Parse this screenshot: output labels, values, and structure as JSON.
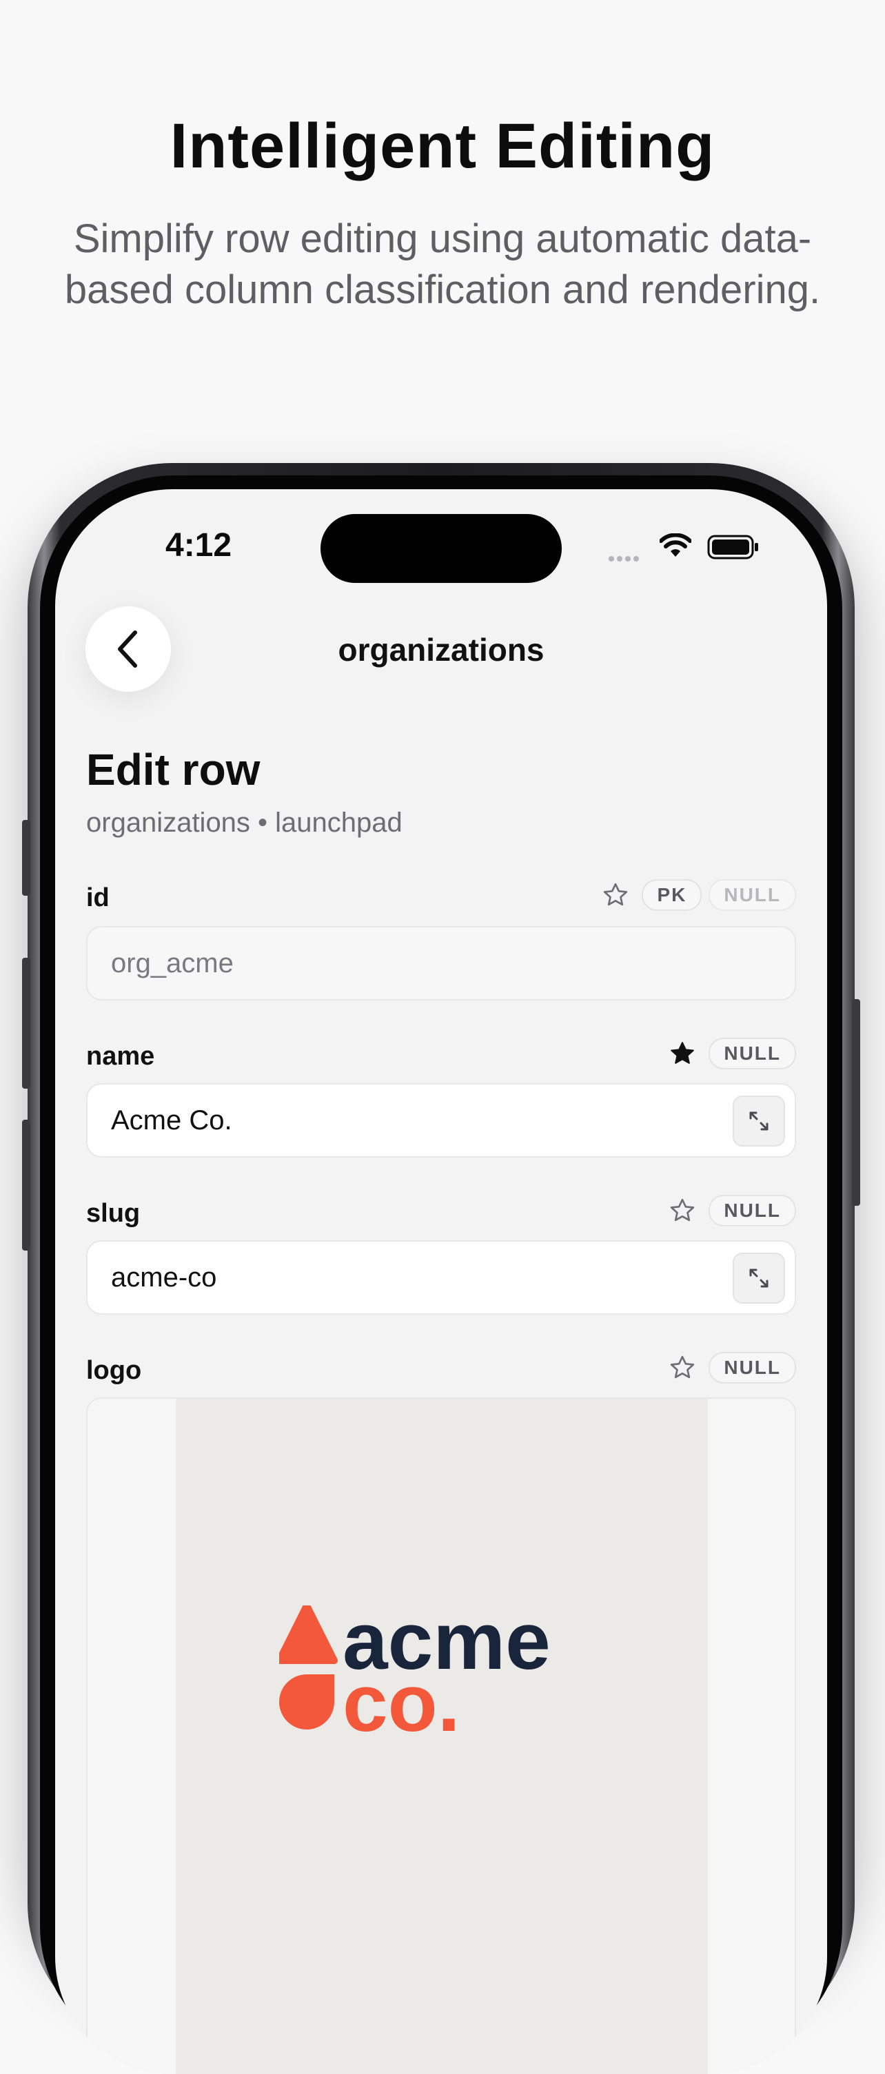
{
  "promo": {
    "headline": "Intelligent Editing",
    "subheadline": "Simplify row editing using automatic data-based column classification and rendering."
  },
  "status_bar": {
    "time": "4:12",
    "icons": [
      "cellular-icon",
      "wifi-icon",
      "battery-icon"
    ]
  },
  "nav": {
    "back_icon": "chevron-left-icon",
    "title": "organizations"
  },
  "page": {
    "title": "Edit row",
    "subtitle": "organizations • launchpad"
  },
  "fields": [
    {
      "label": "id",
      "value": "org_acme",
      "starred": false,
      "badges": [
        "PK",
        "NULL"
      ],
      "readonly": true
    },
    {
      "label": "name",
      "value": "Acme Co.",
      "starred": true,
      "badges": [
        "NULL"
      ],
      "readonly": false
    },
    {
      "label": "slug",
      "value": "acme-co",
      "starred": false,
      "badges": [
        "NULL"
      ],
      "readonly": false
    },
    {
      "label": "logo",
      "starred": false,
      "badges": [
        "NULL"
      ],
      "type": "image"
    }
  ],
  "logo": {
    "line1": "acme",
    "line2": "co.",
    "colors": {
      "accent": "#f4583b",
      "dark": "#18253a",
      "background": "#ebeae7"
    }
  },
  "colors": {
    "page_bg": "#f8f8f8",
    "screen_bg": "#f3f3f3",
    "text": "#111111",
    "muted": "#6e6e72"
  }
}
